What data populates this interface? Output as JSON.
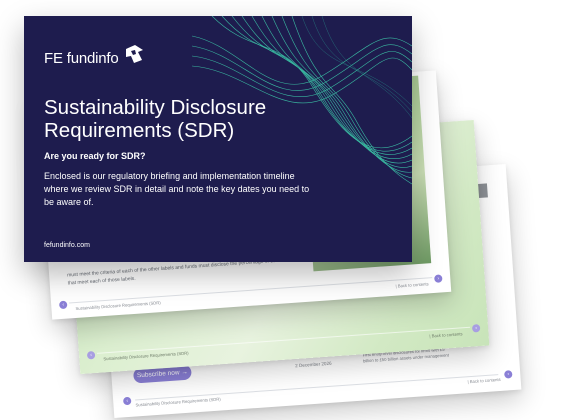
{
  "cover": {
    "brand": "FE fundinfo",
    "title": "Sustainability Disclosure Requirements (SDR)",
    "question": "Are you ready for SDR?",
    "intro": "Enclosed is our regulatory briefing and implementation timeline where we review SDR in detail and note the key dates you need to be aware of.",
    "website": "fefundinfo.com",
    "colors": {
      "background": "#1e1c4e",
      "wave": "#3fd6b0"
    }
  },
  "page1": {
    "body_text": "must meet the criteria of each of the other labels and funds must disclose the percentage of assets that meet each of those labels.",
    "footer_left": "Sustainability Disclosure Requirements (SDR)",
    "footer_right": "| Back to contents"
  },
  "page2": {
    "footer_left": "Sustainability Disclosure Requirements (SDR)",
    "footer_right": "| Back to contents"
  },
  "page3": {
    "subscribe_label": "Subscribe now →",
    "date_label": "2 December 2026",
    "date_text": "First entity-level disclosures for firms with £5 billion to £50 billion assets under management",
    "footer_left": "Sustainability Disclosure Requirements (SDR)",
    "footer_right": "| Back to contents"
  },
  "accent_color": "#8a7fd6"
}
